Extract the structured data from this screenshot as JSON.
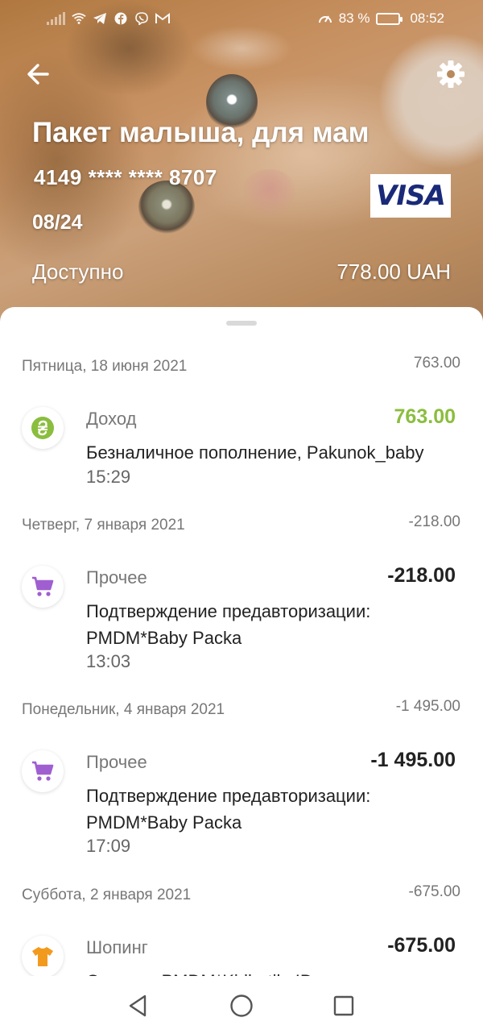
{
  "status_bar": {
    "battery_percent": "83 %",
    "time": "08:52",
    "battery_level": 0.83,
    "left_icons": [
      "signal-icon",
      "wifi-icon",
      "telegram-icon",
      "facebook-icon",
      "viber-icon",
      "gmail-icon"
    ],
    "right_icons": [
      "speed-icon",
      "battery-icon"
    ]
  },
  "header": {
    "title": "Пакет малыша, для мам",
    "card_number": "4149 **** **** 8707",
    "expiry": "08/24",
    "brand": "VISA",
    "available_label": "Доступно",
    "available_amount": "778.00 UAH",
    "icons": [
      "back-arrow-icon",
      "settings-gear-icon"
    ]
  },
  "days": [
    {
      "date": "Пятница, 18 июня 2021",
      "total": "763.00",
      "transactions": [
        {
          "category": "Доход",
          "amount": "763.00",
          "type": "income",
          "icon": "hryvnia-coin-icon",
          "description": "Безналичное пополнение, Pakunok_baby",
          "time": "15:29"
        }
      ]
    },
    {
      "date": "Четверг, 7 января 2021",
      "total": "-218.00",
      "transactions": [
        {
          "category": "Прочее",
          "amount": "-218.00",
          "type": "expense",
          "icon": "shopping-cart-icon",
          "description": "Подтверждение предавторизации: PMDM*Baby Packa",
          "time": "13:03"
        }
      ]
    },
    {
      "date": "Понедельник, 4 января 2021",
      "total": "-1 495.00",
      "transactions": [
        {
          "category": "Прочее",
          "amount": "-1 495.00",
          "type": "expense",
          "icon": "shopping-cart-icon",
          "description": "Подтверждение предавторизации: PMDM*Baby Packa",
          "time": "17:09"
        }
      ]
    },
    {
      "date": "Суббота, 2 января 2021",
      "total": "-675.00",
      "transactions": [
        {
          "category": "Шопинг",
          "amount": "-675.00",
          "type": "expense",
          "icon": "tshirt-icon",
          "description": "Одежда: PMDM*Kidbutik, ID платежа"
        }
      ]
    }
  ],
  "navbar": {
    "icons": [
      "nav-back-icon",
      "nav-home-icon",
      "nav-recents-icon"
    ]
  },
  "colors": {
    "income": "#8bbd3f",
    "cart": "#a05fd0",
    "tshirt": "#f29a1e",
    "coin": "#8bbd3f",
    "visa": "#1a2a78"
  }
}
